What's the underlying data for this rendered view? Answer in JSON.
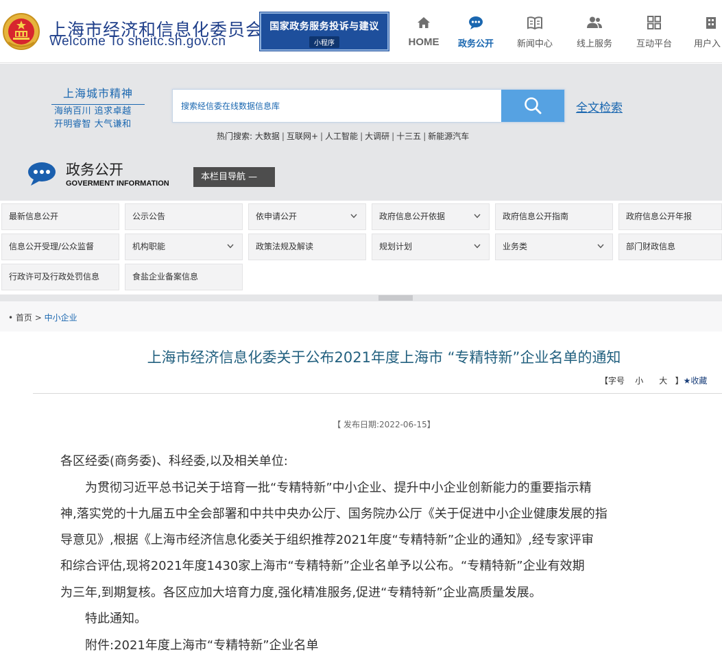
{
  "header": {
    "site_title": "上海市经济和信息化委员会",
    "site_subtitle": "Welcome To sheitc.sh.gov.cn",
    "banner_main": "国家政务服务投诉与建议",
    "banner_sub": "小程序",
    "nav": [
      {
        "label": "HOME",
        "icon": "home-icon"
      },
      {
        "label": "政务公开",
        "icon": "chat-bubble-icon",
        "active": true
      },
      {
        "label": "新闻中心",
        "icon": "book-icon"
      },
      {
        "label": "线上服务",
        "icon": "users-icon"
      },
      {
        "label": "互动平台",
        "icon": "grid-icon"
      },
      {
        "label": "用户入",
        "icon": "building-icon"
      }
    ]
  },
  "motto": {
    "heading": "上海城市精神",
    "line1": "海纳百川 追求卓越",
    "line2": "开明睿智 大气谦和"
  },
  "search": {
    "placeholder": "搜索经信委在线数据信息库",
    "fulltext_label": "全文检索",
    "hot_prefix": "热门搜索:",
    "hot_items": [
      "大数据",
      "互联网+",
      "人工智能",
      "大调研",
      "十三五",
      "新能源汽车"
    ]
  },
  "section": {
    "title": "政务公开",
    "title_en": "GOVERMENT INFORMATION",
    "column_nav_label": "本栏目导航 —"
  },
  "categories": [
    {
      "label": "最新信息公开",
      "dropdown": false
    },
    {
      "label": "公示公告",
      "dropdown": false
    },
    {
      "label": "依申请公开",
      "dropdown": true
    },
    {
      "label": "政府信息公开依据",
      "dropdown": true
    },
    {
      "label": "政府信息公开指南",
      "dropdown": false
    },
    {
      "label": "政府信息公开年报",
      "dropdown": false
    },
    {
      "label": "信息公开受理/公众监督",
      "dropdown": false
    },
    {
      "label": "机构职能",
      "dropdown": true
    },
    {
      "label": "政策法规及解读",
      "dropdown": false
    },
    {
      "label": "规划计划",
      "dropdown": true
    },
    {
      "label": "业务类",
      "dropdown": true
    },
    {
      "label": "部门财政信息",
      "dropdown": false
    },
    {
      "label": "行政许可及行政处罚信息",
      "dropdown": false
    },
    {
      "label": "食盐企业备案信息",
      "dropdown": false
    }
  ],
  "breadcrumb": {
    "bullet": "•",
    "home": "首页",
    "sep": ">",
    "current": "中小企业"
  },
  "article": {
    "title": "上海市经济信息化委关于公布2021年度上海市 “专精特新”企业名单的通知",
    "tools": {
      "open": "【字号",
      "small": "小",
      "large": "大",
      "close": "】",
      "favorite": "★收藏"
    },
    "pubdate": "【 发布日期:2022-06-15】",
    "paragraphs": [
      "各区经委(商务委)、科经委,以及相关单位:",
      "　　为贯彻习近平总书记关于培育一批“专精特新”中小企业、提升中小企业创新能力的重要指示精",
      "神,落实党的十九届五中全会部署和中共中央办公厅、国务院办公厅《关于促进中小企业健康发展的指",
      "导意见》,根据《上海市经济信息化委关于组织推荐2021年度“专精特新”企业的通知》,经专家评审",
      "和综合评估,现将2021年度1430家上海市“专精特新”企业名单予以公布。“专精特新”企业有效期",
      "为三年,到期复核。各区应加大培育力度,强化精准服务,促进“专精特新”企业高质量发展。",
      "　　特此通知。",
      "　　附件:2021年度上海市“专精特新”企业名单"
    ]
  },
  "colors": {
    "brand_blue": "#1f3f8a",
    "link_blue": "#1a67b0",
    "search_button": "#56a2e2",
    "gray_band": "#e5e6e8",
    "title_teal": "#22607f"
  }
}
